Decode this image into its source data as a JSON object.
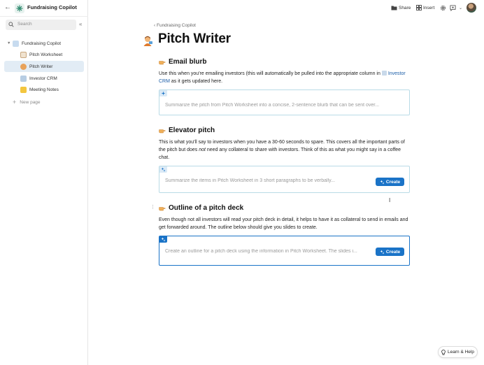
{
  "sidebar": {
    "doc_title": "Fundraising Copilot",
    "search_placeholder": "Search",
    "items": [
      {
        "label": "Fundraising Copilot",
        "icon": "doc-grid-icon"
      },
      {
        "label": "Pitch Worksheet",
        "icon": "worksheet-icon"
      },
      {
        "label": "Pitch Writer",
        "icon": "person-icon"
      },
      {
        "label": "Investor CRM",
        "icon": "crm-icon"
      },
      {
        "label": "Meeting Notes",
        "icon": "notes-icon"
      }
    ],
    "new_page": "New page"
  },
  "topbar": {
    "share": "Share",
    "insert": "Insert"
  },
  "page": {
    "breadcrumb": "Fundraising Copilot",
    "title": "Pitch Writer"
  },
  "sections": [
    {
      "heading": "Email blurb",
      "text_before": "Use this when you're emailing investors (this will automatically be pulled into the appropriate column in ",
      "link": "Investor CRM",
      "text_after": " as it gets updated here.",
      "prompt": "Summarize the pitch from Pitch Worksheet into a concise, 2-sentence blurb that can be sent over..."
    },
    {
      "heading": "Elevator pitch",
      "text_before": "This is what you'll say to investors when you have a 30-60 seconds to spare. This covers all the important parts of the pitch but does ",
      "emph": "not",
      "text_after": " need any collateral to share with investors. Think of this as what you might say in a coffee chat.",
      "prompt": "Summarize the items in Pitch Worksheet in 3 short paragraphs to be verbally...",
      "button": "Create"
    },
    {
      "heading": "Outline of a pitch deck",
      "text": "Even though not all investors will read your pitch deck in detail, it helps to have it as collateral to send in emails and get forwarded around. The outline below should give you slides to create.",
      "prompt": "Create an outline for a pitch deck using the information in Pitch Worksheet. The slides i...",
      "button": "Create"
    }
  ],
  "help": "Learn & Help",
  "colors": {
    "accent": "#1a73c7",
    "active_nav": "#e2ecf5",
    "ai_border": "#b9dbe6",
    "link": "#1d5fa8"
  }
}
